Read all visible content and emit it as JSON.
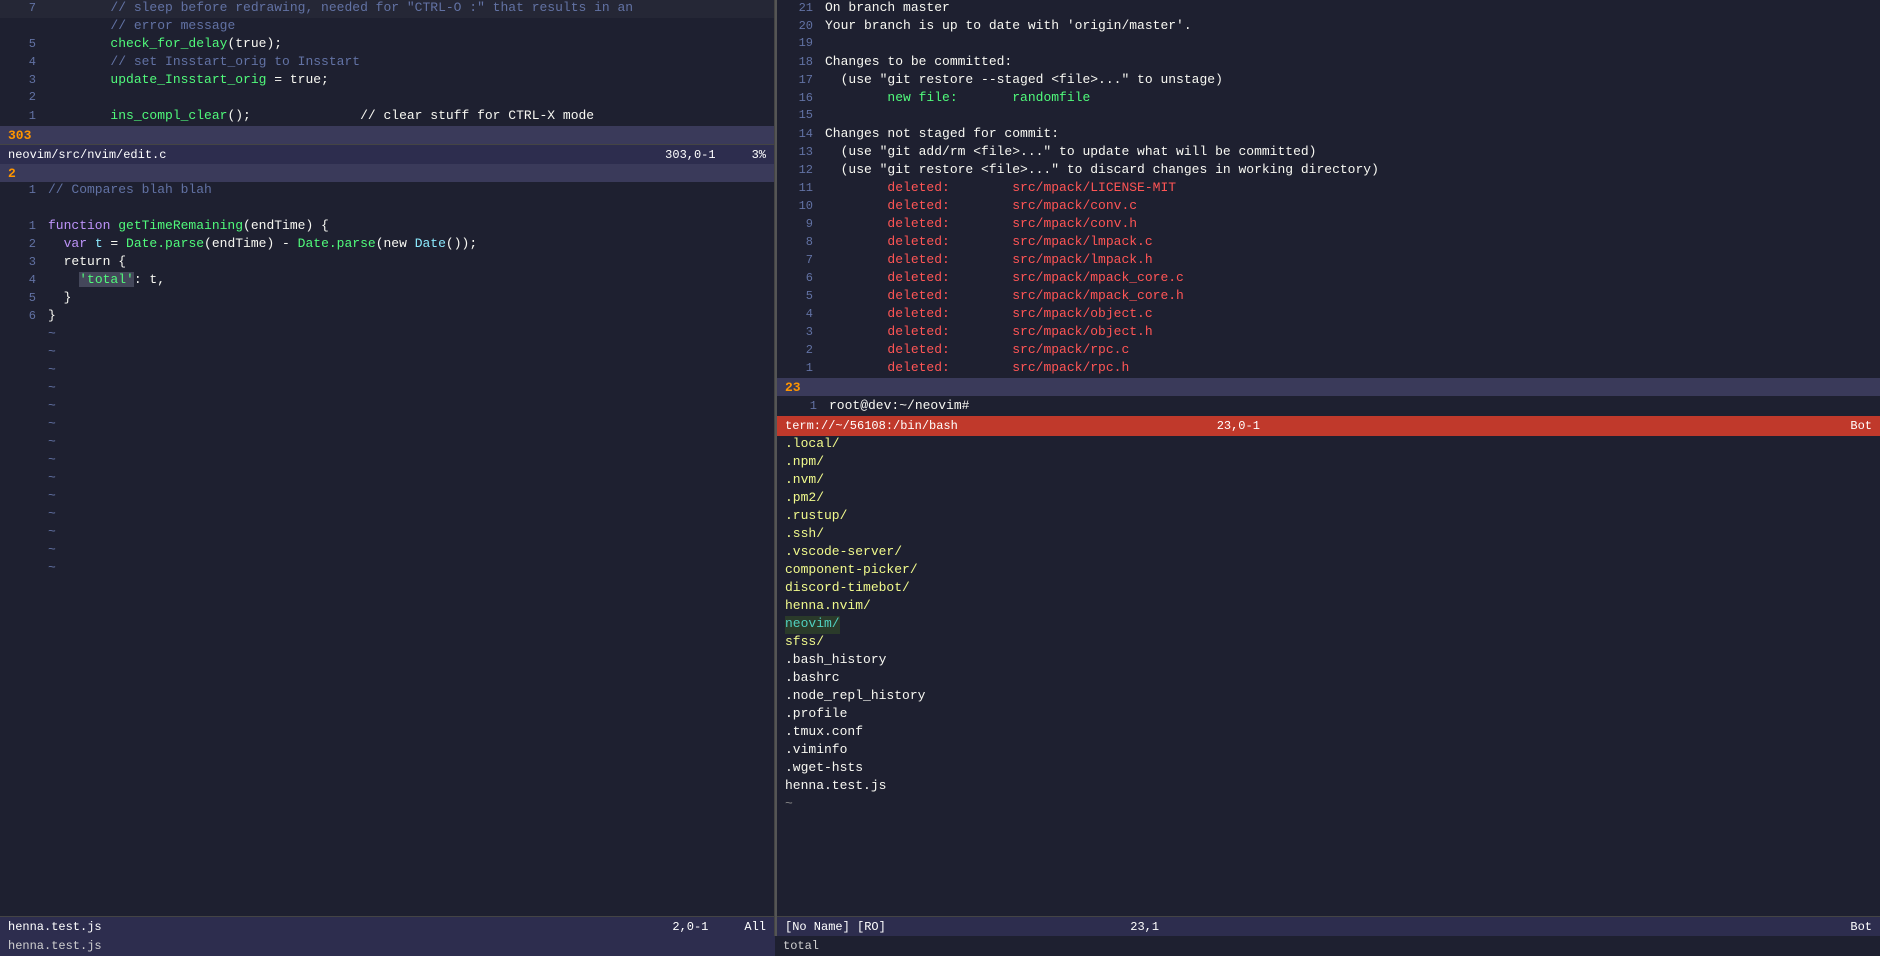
{
  "colors": {
    "bg": "#1e2030",
    "statusbar_normal": "#2d2d4e",
    "statusbar_active": "#4a90d9",
    "terminal_status": "#c0392b",
    "separator": "#3a3a5a"
  },
  "left_pane": {
    "top_section": {
      "lines": [
        {
          "num": "7",
          "content": [
            {
              "text": "\t// sleep before redrawing, needed for \"CTRL-O :\" that results in an",
              "color": "gray"
            }
          ]
        },
        {
          "num": "",
          "content": [
            {
              "text": "\t// error message",
              "color": "gray"
            }
          ]
        },
        {
          "num": "5",
          "content": [
            {
              "text": "\t",
              "color": ""
            },
            {
              "text": "check_for_delay",
              "color": "green"
            },
            {
              "text": "(true);",
              "color": "white"
            }
          ]
        },
        {
          "num": "4",
          "content": [
            {
              "text": "\t",
              "color": ""
            },
            {
              "text": "// set Insstart_orig to Insstart",
              "color": "gray"
            }
          ]
        },
        {
          "num": "3",
          "content": [
            {
              "text": "\t",
              "color": ""
            },
            {
              "text": "update_Insstart_orig",
              "color": "green"
            },
            {
              "text": " = true;",
              "color": "white"
            }
          ]
        },
        {
          "num": "2",
          "content": []
        },
        {
          "num": "1",
          "content": [
            {
              "text": "\t",
              "color": ""
            },
            {
              "text": "ins_compl_clear",
              "color": "green"
            },
            {
              "text": "();\t\t// clear stuff for CTRL-X mode",
              "color": "white"
            }
          ]
        }
      ],
      "separator_num": "303",
      "status_bar": {
        "left": "neovim/src/nvim/edit.c",
        "right": "303,0-1",
        "far_right": "3%"
      }
    },
    "bottom_section": {
      "section_num": "2",
      "lines": [
        {
          "num": "1",
          "content": [
            {
              "text": "// Compares blah blah",
              "color": "gray"
            }
          ]
        },
        {
          "num": "",
          "content": []
        },
        {
          "num": "1",
          "content": [
            {
              "text": "function ",
              "color": "purple"
            },
            {
              "text": "getTimeRemaining",
              "color": "green"
            },
            {
              "text": "(endTime) {",
              "color": "white"
            }
          ]
        },
        {
          "num": "2",
          "content": [
            {
              "text": "  var ",
              "color": "purple"
            },
            {
              "text": "t",
              "color": "cyan"
            },
            {
              "text": " = ",
              "color": "white"
            },
            {
              "text": "Date.parse",
              "color": "green"
            },
            {
              "text": "(endTime) - ",
              "color": "white"
            },
            {
              "text": "Date.parse",
              "color": "green"
            },
            {
              "text": "(new ",
              "color": "white"
            },
            {
              "text": "Date",
              "color": "cyan"
            },
            {
              "text": "());",
              "color": "white"
            }
          ]
        },
        {
          "num": "3",
          "content": [
            {
              "text": "  return {",
              "color": "white"
            }
          ]
        },
        {
          "num": "4",
          "content": [
            {
              "text": "    ",
              "color": ""
            },
            {
              "text": "'total'",
              "color": "selected"
            },
            {
              "text": ": t,",
              "color": "white"
            }
          ]
        },
        {
          "num": "5",
          "content": [
            {
              "text": "  }",
              "color": "white"
            }
          ]
        },
        {
          "num": "6",
          "content": [
            {
              "text": "}",
              "color": "white"
            }
          ]
        }
      ],
      "tildes": [
        "~",
        "~",
        "~",
        "~",
        "~",
        "~",
        "~",
        "~",
        "~",
        "~",
        "~",
        "~",
        "~",
        "~"
      ],
      "status_bar": {
        "left": "henna.test.js",
        "right": "2,0-1",
        "far_right": "All"
      }
    }
  },
  "right_pane": {
    "top_section": {
      "lines": [
        {
          "num": "21",
          "content": [
            {
              "text": "On branch master",
              "color": "white"
            }
          ]
        },
        {
          "num": "20",
          "content": [
            {
              "text": "Your branch is up to date with 'origin/master'.",
              "color": "white"
            }
          ]
        },
        {
          "num": "19",
          "content": []
        },
        {
          "num": "18",
          "content": [
            {
              "text": "Changes to be committed:",
              "color": "white"
            }
          ]
        },
        {
          "num": "17",
          "content": [
            {
              "text": "  (use \"git restore --staged <file>...\" to unstage)",
              "color": "white"
            }
          ]
        },
        {
          "num": "16",
          "content": [
            {
              "text": "\tnew file:\t",
              "color": "green"
            },
            {
              "text": "randomfile",
              "color": "green"
            }
          ]
        },
        {
          "num": "15",
          "content": []
        },
        {
          "num": "14",
          "content": [
            {
              "text": "Changes not staged for commit:",
              "color": "white"
            }
          ]
        },
        {
          "num": "13",
          "content": [
            {
              "text": "  (use \"git add/rm <file>...\" to update what will be committed)",
              "color": "white"
            }
          ]
        },
        {
          "num": "12",
          "content": [
            {
              "text": "  (use \"git restore <file>...\" to discard changes in working directory)",
              "color": "white"
            }
          ]
        },
        {
          "num": "11",
          "content": [
            {
              "text": "\tdeleted:\t",
              "color": "red"
            },
            {
              "text": "src/mpack/LICENSE-MIT",
              "color": "red"
            }
          ]
        },
        {
          "num": "10",
          "content": [
            {
              "text": "\tdeleted:\t",
              "color": "red"
            },
            {
              "text": "src/mpack/conv.c",
              "color": "red"
            }
          ]
        },
        {
          "num": "9",
          "content": [
            {
              "text": "\tdeleted:\t",
              "color": "red"
            },
            {
              "text": "src/mpack/conv.h",
              "color": "red"
            }
          ]
        },
        {
          "num": "8",
          "content": [
            {
              "text": "\tdeleted:\t",
              "color": "red"
            },
            {
              "text": "src/mpack/lmpack.c",
              "color": "red"
            }
          ]
        },
        {
          "num": "7",
          "content": [
            {
              "text": "\tdeleted:\t",
              "color": "red"
            },
            {
              "text": "src/mpack/lmpack.h",
              "color": "red"
            }
          ]
        },
        {
          "num": "6",
          "content": [
            {
              "text": "\tdeleted:\t",
              "color": "red"
            },
            {
              "text": "src/mpack/mpack_core.c",
              "color": "red"
            }
          ]
        },
        {
          "num": "5",
          "content": [
            {
              "text": "\tdeleted:\t",
              "color": "red"
            },
            {
              "text": "src/mpack/mpack_core.h",
              "color": "red"
            }
          ]
        },
        {
          "num": "4",
          "content": [
            {
              "text": "\tdeleted:\t",
              "color": "red"
            },
            {
              "text": "src/mpack/object.c",
              "color": "red"
            }
          ]
        },
        {
          "num": "3",
          "content": [
            {
              "text": "\tdeleted:\t",
              "color": "red"
            },
            {
              "text": "src/mpack/object.h",
              "color": "red"
            }
          ]
        },
        {
          "num": "2",
          "content": [
            {
              "text": "\tdeleted:\t",
              "color": "red"
            },
            {
              "text": "src/mpack/rpc.c",
              "color": "red"
            }
          ]
        },
        {
          "num": "1",
          "content": [
            {
              "text": "\tdeleted:\t",
              "color": "red"
            },
            {
              "text": "src/mpack/rpc.h",
              "color": "red"
            }
          ]
        }
      ],
      "separator_num": "23",
      "status_bar": {
        "left": "1   root@dev:~/neovim#",
        "terminal_label": "term://~/56108:/bin/bash",
        "right": "23,0-1",
        "far_right": "Bot"
      }
    },
    "bottom_section": {
      "files": [
        {
          "name": ".local/",
          "color": "yellow"
        },
        {
          "name": ".npm/",
          "color": "yellow"
        },
        {
          "name": ".nvm/",
          "color": "yellow"
        },
        {
          "name": ".pm2/",
          "color": "yellow"
        },
        {
          "name": ".rustup/",
          "color": "yellow"
        },
        {
          "name": ".ssh/",
          "color": "yellow"
        },
        {
          "name": ".vscode-server/",
          "color": "yellow"
        },
        {
          "name": "component-picker/",
          "color": "yellow"
        },
        {
          "name": "discord-timebot/",
          "color": "yellow"
        },
        {
          "name": "henna.nvim/",
          "color": "yellow"
        },
        {
          "name": "neovim/",
          "color": "cyan_highlight"
        },
        {
          "name": "sfss/",
          "color": "yellow"
        },
        {
          "name": ".bash_history",
          "color": "white"
        },
        {
          "name": ".bashrc",
          "color": "white"
        },
        {
          "name": ".node_repl_history",
          "color": "white"
        },
        {
          "name": ".profile",
          "color": "white"
        },
        {
          "name": ".tmux.conf",
          "color": "white"
        },
        {
          "name": ".viminfo",
          "color": "white"
        },
        {
          "name": ".wget-hsts",
          "color": "white"
        },
        {
          "name": "henna.test.js",
          "color": "white"
        },
        {
          "name": "~",
          "color": "dimgray"
        }
      ],
      "status_bar": {
        "left": "[No Name] [RO]",
        "right": "23,1",
        "far_right": "Bot"
      }
    }
  },
  "bottom_bar": {
    "left_file": "henna.test.js",
    "left_cmd": "total",
    "right_cmd": ""
  }
}
